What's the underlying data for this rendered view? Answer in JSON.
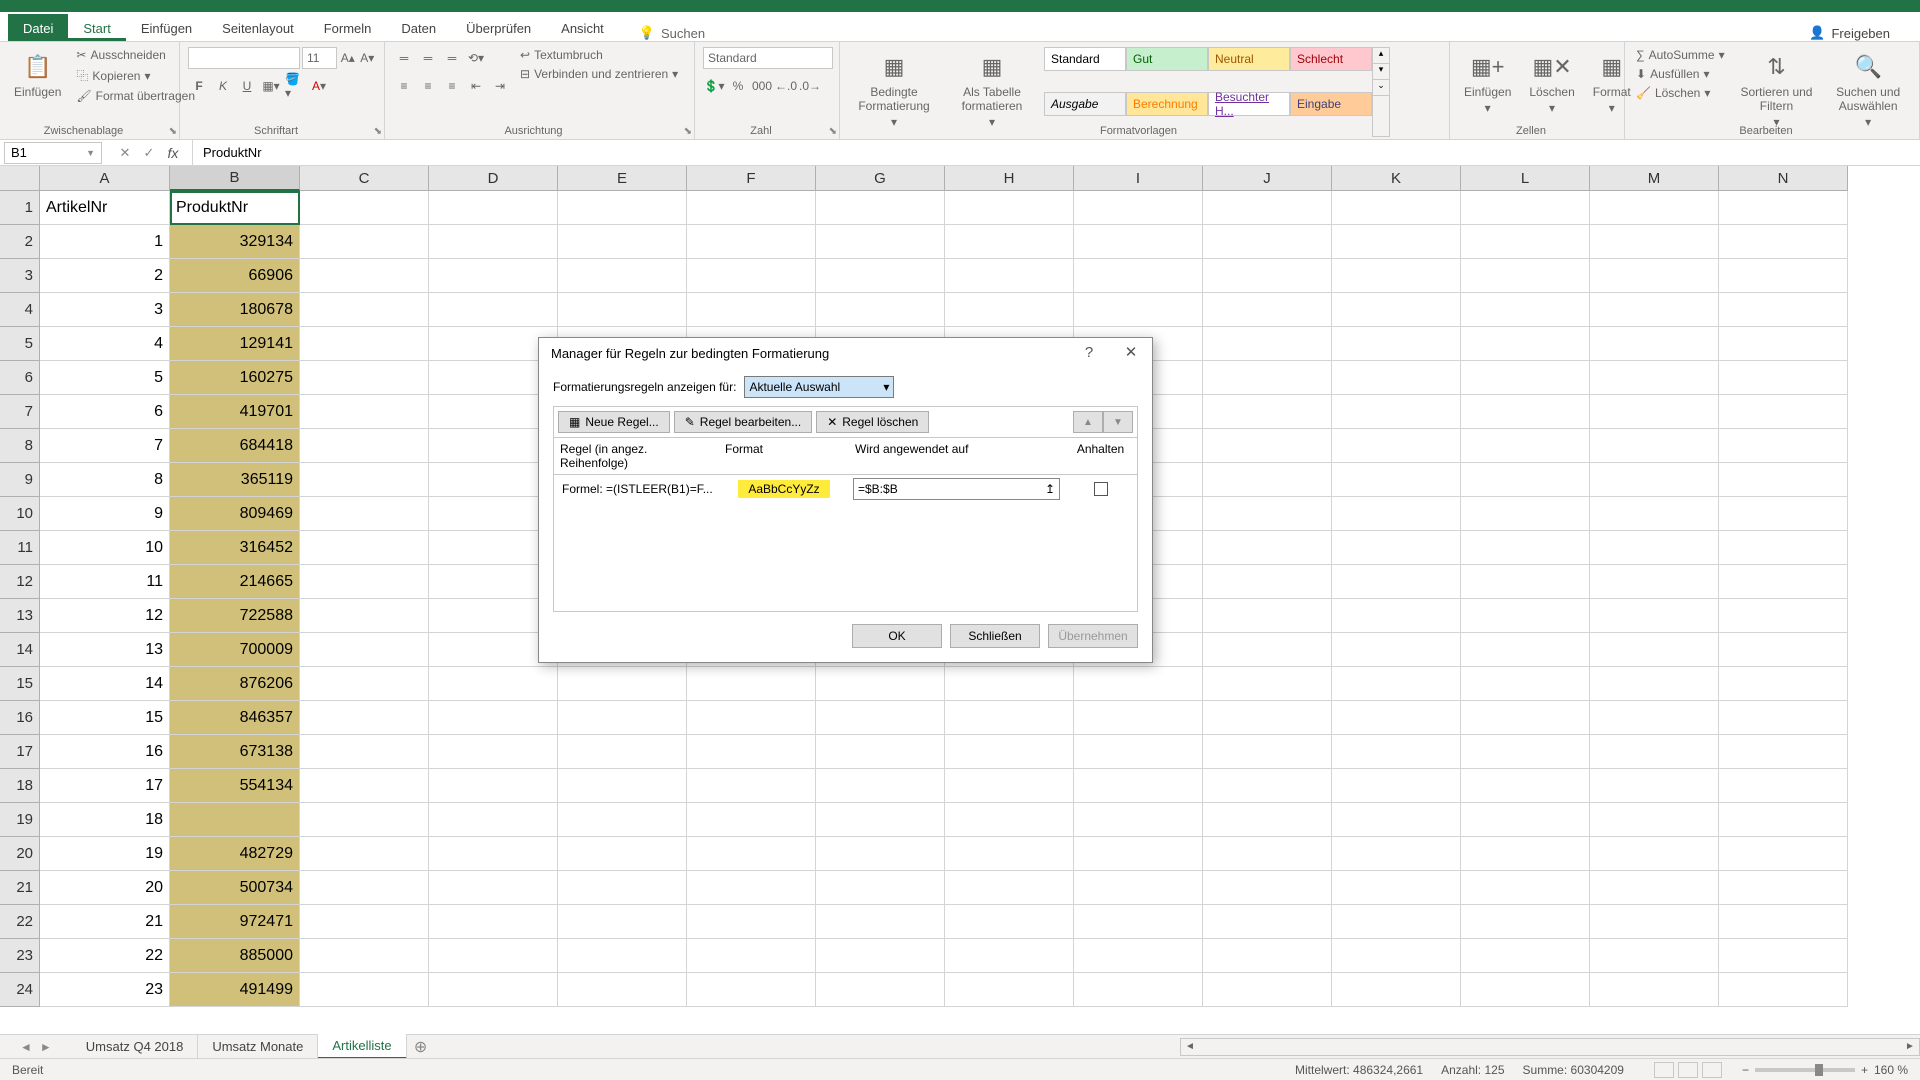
{
  "menu": {
    "file": "Datei",
    "tabs": [
      "Start",
      "Einfügen",
      "Seitenlayout",
      "Formeln",
      "Daten",
      "Überprüfen",
      "Ansicht"
    ],
    "active": "Start",
    "search": "Suchen",
    "share": "Freigeben"
  },
  "ribbon": {
    "clipboard": {
      "label": "Zwischenablage",
      "paste": "Einfügen",
      "cut": "Ausschneiden",
      "copy": "Kopieren",
      "format_painter": "Format übertragen"
    },
    "font": {
      "label": "Schriftart",
      "size": "11"
    },
    "alignment": {
      "label": "Ausrichtung",
      "wrap": "Textumbruch",
      "merge": "Verbinden und zentrieren"
    },
    "number": {
      "label": "Zahl",
      "format": "Standard"
    },
    "cond_format": "Bedingte Formatierung",
    "table_format": "Als Tabelle formatieren",
    "styles": {
      "label": "Formatvorlagen",
      "normal": "Standard",
      "gut": "Gut",
      "neutral": "Neutral",
      "schlecht": "Schlecht",
      "ausgabe": "Ausgabe",
      "berechnung": "Berechnung",
      "besucht": "Besuchter H...",
      "eingabe": "Eingabe"
    },
    "cells": {
      "label": "Zellen",
      "insert": "Einfügen",
      "delete": "Löschen",
      "format": "Format"
    },
    "editing": {
      "label": "Bearbeiten",
      "autosum": "AutoSumme",
      "fill": "Ausfüllen",
      "clear": "Löschen",
      "sort": "Sortieren und Filtern",
      "find": "Suchen und Auswählen"
    }
  },
  "namebox": "B1",
  "formula": "ProduktNr",
  "columns": [
    "A",
    "B",
    "C",
    "D",
    "E",
    "F",
    "G",
    "H",
    "I",
    "J",
    "K",
    "L",
    "M",
    "N"
  ],
  "sheet": {
    "headers": [
      "ArtikelNr",
      "ProduktNr"
    ],
    "rows": [
      [
        1,
        329134
      ],
      [
        2,
        66906
      ],
      [
        3,
        180678
      ],
      [
        4,
        129141
      ],
      [
        5,
        160275
      ],
      [
        6,
        419701
      ],
      [
        7,
        684418
      ],
      [
        8,
        365119
      ],
      [
        9,
        809469
      ],
      [
        10,
        316452
      ],
      [
        11,
        214665
      ],
      [
        12,
        722588
      ],
      [
        13,
        700009
      ],
      [
        14,
        876206
      ],
      [
        15,
        846357
      ],
      [
        16,
        673138
      ],
      [
        17,
        554134
      ],
      [
        18,
        ""
      ],
      [
        19,
        482729
      ],
      [
        20,
        500734
      ],
      [
        21,
        972471
      ],
      [
        22,
        885000
      ],
      [
        23,
        491499
      ]
    ]
  },
  "dialog": {
    "title": "Manager für Regeln zur bedingten Formatierung",
    "show_for_label": "Formatierungsregeln anzeigen für:",
    "show_for_value": "Aktuelle Auswahl",
    "new_rule": "Neue Regel...",
    "edit_rule": "Regel bearbeiten...",
    "delete_rule": "Regel löschen",
    "col_rule": "Regel (in angez. Reihenfolge)",
    "col_format": "Format",
    "col_applies": "Wird angewendet auf",
    "col_stop": "Anhalten",
    "rule_text": "Formel: =(ISTLEER(B1)=F...",
    "format_sample": "AaBbCcYyZz",
    "applies_to": "=$B:$B",
    "ok": "OK",
    "close": "Schließen",
    "apply": "Übernehmen"
  },
  "sheet_tabs": {
    "tabs": [
      "Umsatz Q4 2018",
      "Umsatz Monate",
      "Artikelliste"
    ],
    "active": "Artikelliste"
  },
  "status": {
    "ready": "Bereit",
    "avg_label": "Mittelwert:",
    "avg": "486324,2661",
    "count_label": "Anzahl:",
    "count": "125",
    "sum_label": "Summe:",
    "sum": "60304209",
    "zoom": "160 %"
  }
}
